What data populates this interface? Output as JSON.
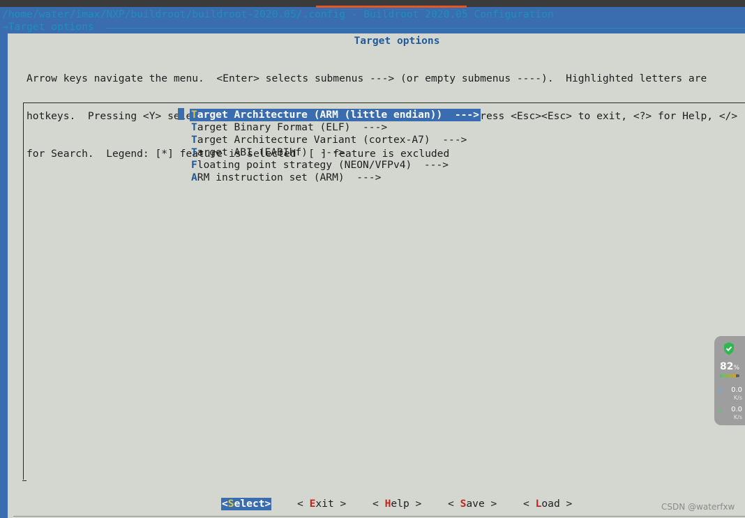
{
  "window": {
    "title": "/home/water/imax/NXP/buildroot/buildroot-2020.05/.config - Buildroot 2020.05 Configuration",
    "breadcrumb": "→Target options"
  },
  "panel": {
    "title": "Target options",
    "help_lines": [
      "Arrow keys navigate the menu.  <Enter> selects submenus ---> (or empty submenus ----).  Highlighted letters are",
      "hotkeys.  Pressing <Y> selects a feature, while <N> excludes a feature.  Press <Esc><Esc> to exit, <?> for Help, </>",
      "for Search.  Legend: [*] feature is selected  [ ] feature is excluded"
    ]
  },
  "menu": {
    "items": [
      {
        "hotkey": "T",
        "rest": "arget Architecture (ARM (little endian))  --->",
        "selected": true
      },
      {
        "hotkey": "T",
        "rest": "arget Binary Format (ELF)  --->",
        "selected": false
      },
      {
        "hotkey": "T",
        "rest": "arget Architecture Variant (cortex-A7)  --->",
        "selected": false
      },
      {
        "hotkey": "T",
        "rest": "arget ABI (EABIhf)  --->",
        "selected": false
      },
      {
        "hotkey": "F",
        "rest": "loating point strategy (NEON/VFPv4)  --->",
        "selected": false
      },
      {
        "hotkey": "A",
        "rest": "RM instruction set (ARM)  --->",
        "selected": false
      }
    ]
  },
  "buttons": [
    {
      "open": "<",
      "hotkey": "S",
      "rest": "elect",
      "close": ">",
      "selected": true
    },
    {
      "open": "< ",
      "hotkey": "E",
      "rest": "xit",
      "close": " >",
      "selected": false
    },
    {
      "open": "< ",
      "hotkey": "H",
      "rest": "elp",
      "close": " >",
      "selected": false
    },
    {
      "open": "< ",
      "hotkey": "S",
      "rest": "ave",
      "close": " >",
      "selected": false
    },
    {
      "open": "< ",
      "hotkey": "L",
      "rest": "oad",
      "close": " >",
      "selected": false
    }
  ],
  "overlay_widget": {
    "battery_percent": "82",
    "battery_unit": "%",
    "battery_fraction": 0.82,
    "upload_rate": "0.0",
    "download_rate": "0.0",
    "rate_unit": "K/s",
    "icons": [
      "shield-check-icon",
      "upload-arrow-icon",
      "download-arrow-icon"
    ]
  },
  "watermark": "CSDN @waterfxw",
  "colors": {
    "terminal_blue": "#3a6db0",
    "panel_gray": "#d3d7cf",
    "title_cyan": "#1f8fb8",
    "hotkey_blue": "#1f5a9b",
    "button_hotkey_red": "#c0261c",
    "selected_hotkey_yellow": "#d8c84b"
  }
}
